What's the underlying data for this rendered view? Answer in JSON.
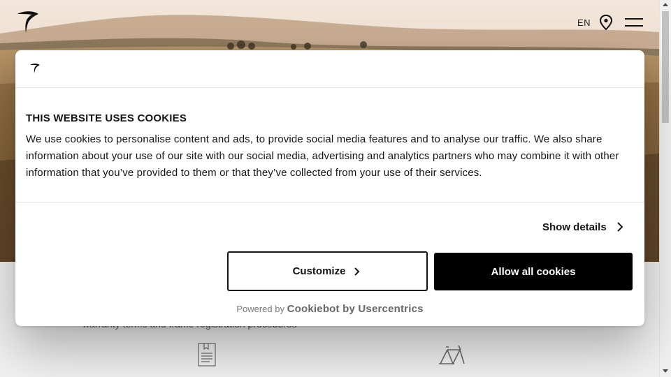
{
  "site": {
    "language": "EN",
    "partial_text": "warranty terms and frame registration procedures"
  },
  "icons": {
    "logo": "pinarello-logo-icon",
    "location": "location-pin-icon",
    "menu": "hamburger-menu-icon",
    "document": "document-icon",
    "bike_frame": "bike-frame-icon"
  },
  "cookie_dialog": {
    "title": "THIS WEBSITE USES COOKIES",
    "body": "We use cookies to personalise content and ads, to provide social media features and to analyse our traffic. We also share information about your use of our site with our social media, advertising and analytics partners who may combine it with other information that you’ve provided to them or that they’ve collected from your use of their services.",
    "show_details_label": "Show details",
    "customize_label": "Customize",
    "allow_all_label": "Allow all cookies",
    "powered_by_prefix": "Powered by",
    "powered_by_brand": "Cookiebot by Usercentrics"
  },
  "colors": {
    "primary_button_bg": "#000000",
    "primary_button_text": "#ffffff",
    "dialog_bg": "#ffffff",
    "text": "#141414"
  }
}
